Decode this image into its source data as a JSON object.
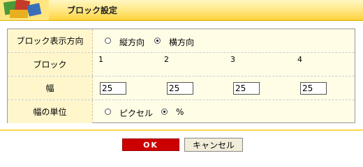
{
  "header": {
    "title": "ブロック設定"
  },
  "rows": {
    "direction": {
      "label": "ブロック表示方向",
      "options": [
        {
          "label": "縦方向",
          "checked": false
        },
        {
          "label": "横方向",
          "checked": true
        }
      ]
    },
    "block": {
      "label": "ブロック",
      "numbers": [
        "1",
        "2",
        "3",
        "4"
      ]
    },
    "width": {
      "label": "幅",
      "values": [
        "25",
        "25",
        "25",
        "25"
      ]
    },
    "unit": {
      "label": "幅の単位",
      "options": [
        {
          "label": "ピクセル",
          "checked": false
        },
        {
          "label": "%",
          "checked": true
        }
      ]
    }
  },
  "buttons": {
    "ok": "OK",
    "cancel": "キャンセル"
  }
}
